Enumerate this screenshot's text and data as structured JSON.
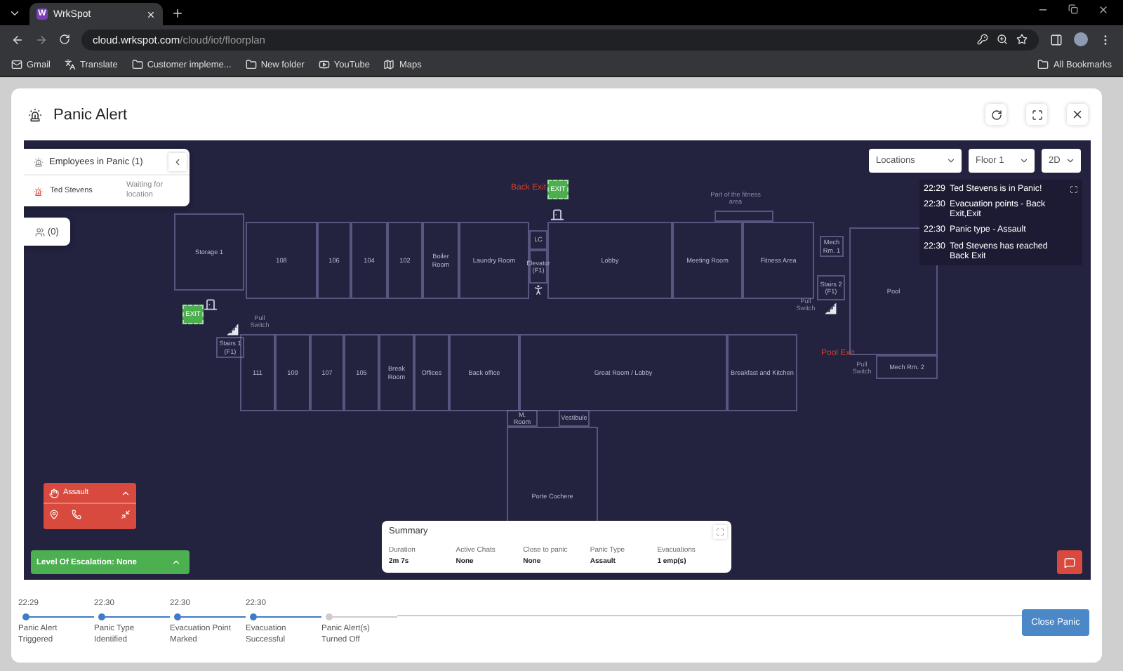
{
  "browser": {
    "tab_title": "WrkSpot",
    "tab_icon_letter": "W",
    "url_host": "cloud.wrkspot.com",
    "url_path": "/cloud/iot/floorplan",
    "bookmarks": [
      "Gmail",
      "Translate",
      "Customer impleme...",
      "New folder",
      "YouTube",
      "Maps"
    ],
    "all_bookmarks": "All Bookmarks"
  },
  "modal": {
    "title": "Panic Alert"
  },
  "employees_panel": {
    "title": "Employees in Panic (1)",
    "rows": [
      {
        "name": "Ted Stevens",
        "status": "Waiting for location"
      }
    ]
  },
  "people_count": "(0)",
  "filters": [
    {
      "label": "Locations"
    },
    {
      "label": "Floor 1"
    },
    {
      "label": "2D"
    }
  ],
  "event_log": [
    {
      "time": "22:29",
      "text": "Ted Stevens is in Panic!"
    },
    {
      "time": "22:30",
      "text": "Evacuation points - Back Exit,Exit"
    },
    {
      "time": "22:30",
      "text": "Panic type - Assault"
    },
    {
      "time": "22:30",
      "text": "Ted Stevens has reached Back Exit"
    }
  ],
  "floorplan": {
    "rooms": [
      "Storage 1",
      "108",
      "106",
      "104",
      "102",
      "Boiler Room",
      "Laundry Room",
      "LC",
      "Elevator (F1)",
      "Lobby",
      "Meeting Room",
      "Fitness Area",
      "Mech Rm. 1",
      "Stairs 2 (F1)",
      "Pool",
      "Mech Rm. 2",
      "Stairs 1 (F1)",
      "111",
      "109",
      "107",
      "105",
      "Break Room",
      "Offices",
      "Back office",
      "Great Room / Lobby",
      "Breakfast and Kitchen",
      "M. Room",
      "Vestibule",
      "Porte Cochere"
    ],
    "labels": [
      {
        "kind": "note",
        "text": "Part of the fitness area"
      },
      {
        "kind": "switch",
        "text": "Pull Switch"
      },
      {
        "kind": "switch",
        "text": "Pull Switch"
      },
      {
        "kind": "switch",
        "text": "Pull Switch"
      },
      {
        "kind": "exit",
        "text": "Pool Exit"
      },
      {
        "kind": "exit",
        "text": "Back Exit"
      }
    ],
    "exit_signs": [
      "EXIT",
      "EXIT"
    ]
  },
  "panic_type_card": {
    "title": "Assault"
  },
  "escalation": {
    "label": "Level Of Escalation: None"
  },
  "summary": {
    "title": "Summary",
    "items": [
      {
        "label": "Duration",
        "value": "2m 7s"
      },
      {
        "label": "Active Chats",
        "value": "None"
      },
      {
        "label": "Close to panic",
        "value": "None"
      },
      {
        "label": "Panic Type",
        "value": "Assault"
      },
      {
        "label": "Evacuations",
        "value": "1 emp(s)"
      }
    ]
  },
  "timeline": [
    {
      "time": "22:29",
      "label": "Panic Alert Triggered",
      "done": true
    },
    {
      "time": "22:30",
      "label": "Panic Type Identified",
      "done": true
    },
    {
      "time": "22:30",
      "label": "Evacuation Point Marked",
      "done": true
    },
    {
      "time": "22:30",
      "label": "Evacuation Successful",
      "done": true
    },
    {
      "label": "Panic Alert(s) Turned Off",
      "done": false
    }
  ],
  "close_button": "Close Panic"
}
